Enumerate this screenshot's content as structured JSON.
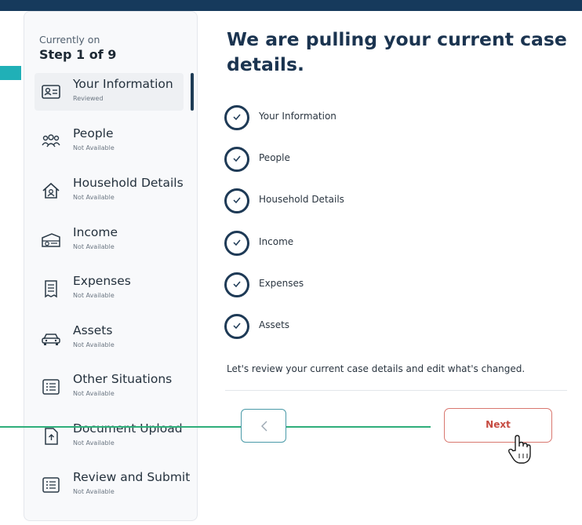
{
  "header": {
    "current_label": "Currently on",
    "step_label": "Step 1 of 9"
  },
  "sidebar": {
    "items": [
      {
        "label": "Your Information",
        "status": "Reviewed",
        "icon": "id-card-icon",
        "active": true
      },
      {
        "label": "People",
        "status": "Not Available",
        "icon": "people-icon"
      },
      {
        "label": "Household Details",
        "status": "Not Available",
        "icon": "house-icon"
      },
      {
        "label": "Income",
        "status": "Not Available",
        "icon": "money-icon"
      },
      {
        "label": "Expenses",
        "status": "Not Available",
        "icon": "receipt-icon"
      },
      {
        "label": "Assets",
        "status": "Not Available",
        "icon": "car-icon"
      },
      {
        "label": "Other Situations",
        "status": "Not Available",
        "icon": "list-icon"
      },
      {
        "label": "Document Upload",
        "status": "Not Available",
        "icon": "upload-doc-icon"
      },
      {
        "label": "Review and Submit",
        "status": "Not Available",
        "icon": "list-icon"
      }
    ]
  },
  "main": {
    "title": "We are pulling your current case details.",
    "checklist": [
      {
        "label": "Your Information",
        "icon": "check-circle-icon"
      },
      {
        "label": "People",
        "icon": "check-circle-icon"
      },
      {
        "label": "Household Details",
        "icon": "check-circle-icon"
      },
      {
        "label": "Income",
        "icon": "check-circle-icon"
      },
      {
        "label": "Expenses",
        "icon": "check-circle-icon"
      },
      {
        "label": "Assets",
        "icon": "check-circle-icon"
      }
    ],
    "review_text": "Let's review your current case details and edit what's changed."
  },
  "buttons": {
    "next_label": "Next",
    "back_icon": "chevron-left-icon"
  },
  "colors": {
    "primary": "#1b3450",
    "topbar": "#163a5c",
    "accent_teal": "#20b0b7",
    "next_border": "#d9776f",
    "next_text": "#c64a40",
    "back_border": "#4a9aa8",
    "green_line": "#2eae7a"
  }
}
